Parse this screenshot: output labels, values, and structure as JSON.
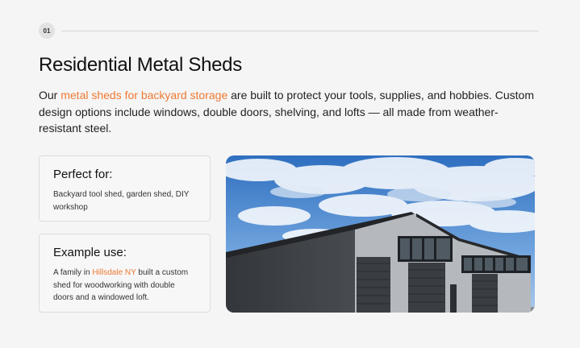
{
  "step": {
    "number": "01"
  },
  "section": {
    "title": "Residential Metal Sheds",
    "intro_before": "Our ",
    "intro_link": "metal sheds for backyard storage",
    "intro_after": " are built to protect your tools, supplies, and hobbies. Custom design options include windows, double doors, shelving, and lofts — all made from weather-resistant steel."
  },
  "cards": {
    "perfect_for": {
      "title": "Perfect for:",
      "body": "Backyard tool shed, garden shed, DIY workshop"
    },
    "example_use": {
      "title": "Example use:",
      "body_before": "A family in ",
      "body_link": "Hillsdale NY",
      "body_after": " built a custom shed for woodworking with double doors and a windowed loft."
    }
  },
  "colors": {
    "accent": "#ee7a33",
    "background": "#f5f5f5",
    "card_border": "#dcdcdc"
  }
}
